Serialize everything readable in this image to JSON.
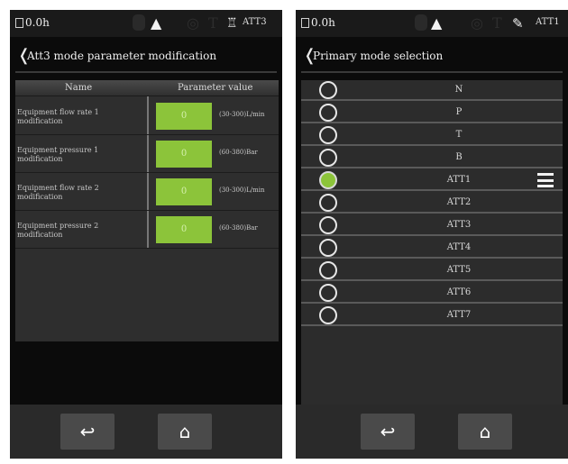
{
  "left_screen": {
    "status": {
      "hours": "0.0h",
      "mode": "ATT3"
    },
    "title": "Att3 mode parameter modification",
    "table": {
      "headers": {
        "name": "Name",
        "value": "Parameter value"
      },
      "rows": [
        {
          "name": "Equipment flow rate 1 modification",
          "value": "0",
          "range": "(30-300)L/min"
        },
        {
          "name": "Equipment pressure 1 modification",
          "value": "0",
          "range": "(60-380)Bar"
        },
        {
          "name": "Equipment flow rate 2 modification",
          "value": "0",
          "range": "(30-300)L/min"
        },
        {
          "name": "Equipment pressure 2 modification",
          "value": "0",
          "range": "(60-380)Bar"
        }
      ]
    },
    "nav": {
      "back_icon": "↩",
      "home_icon": "⌂"
    }
  },
  "right_screen": {
    "status": {
      "hours": "0.0h",
      "mode": "ATT1"
    },
    "title": "Primary mode selection",
    "modes": [
      {
        "label": "N",
        "selected": false
      },
      {
        "label": "P",
        "selected": false
      },
      {
        "label": "T",
        "selected": false
      },
      {
        "label": "B",
        "selected": false
      },
      {
        "label": "ATT1",
        "selected": true
      },
      {
        "label": "ATT2",
        "selected": false
      },
      {
        "label": "ATT3",
        "selected": false
      },
      {
        "label": "ATT4",
        "selected": false
      },
      {
        "label": "ATT5",
        "selected": false
      },
      {
        "label": "ATT6",
        "selected": false
      },
      {
        "label": "ATT7",
        "selected": false
      }
    ],
    "nav": {
      "back_icon": "↩",
      "home_icon": "⌂"
    }
  },
  "colors": {
    "accent_green": "#8cc43a",
    "panel": "#2e2e2e",
    "background": "#0b0b0b"
  }
}
